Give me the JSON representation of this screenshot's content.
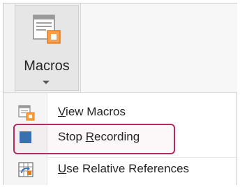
{
  "ribbon": {
    "macros_button": {
      "label": "Macros",
      "icon": "macros-icon",
      "caret": "chevron-down-icon"
    }
  },
  "menu": {
    "items": [
      {
        "label_prefix": "",
        "label_accel": "V",
        "label_rest": "iew Macros",
        "icon": "view-macros-icon"
      },
      {
        "label_prefix": "Stop ",
        "label_accel": "R",
        "label_rest": "ecording",
        "icon": "stop-recording-icon"
      },
      {
        "label_prefix": "",
        "label_accel": "U",
        "label_rest": "se Relative References",
        "icon": "relative-references-icon"
      }
    ]
  },
  "colors": {
    "stop_square": "#3a6fb0",
    "highlight": "#b52b60",
    "icon_orange": "#e07b22"
  }
}
